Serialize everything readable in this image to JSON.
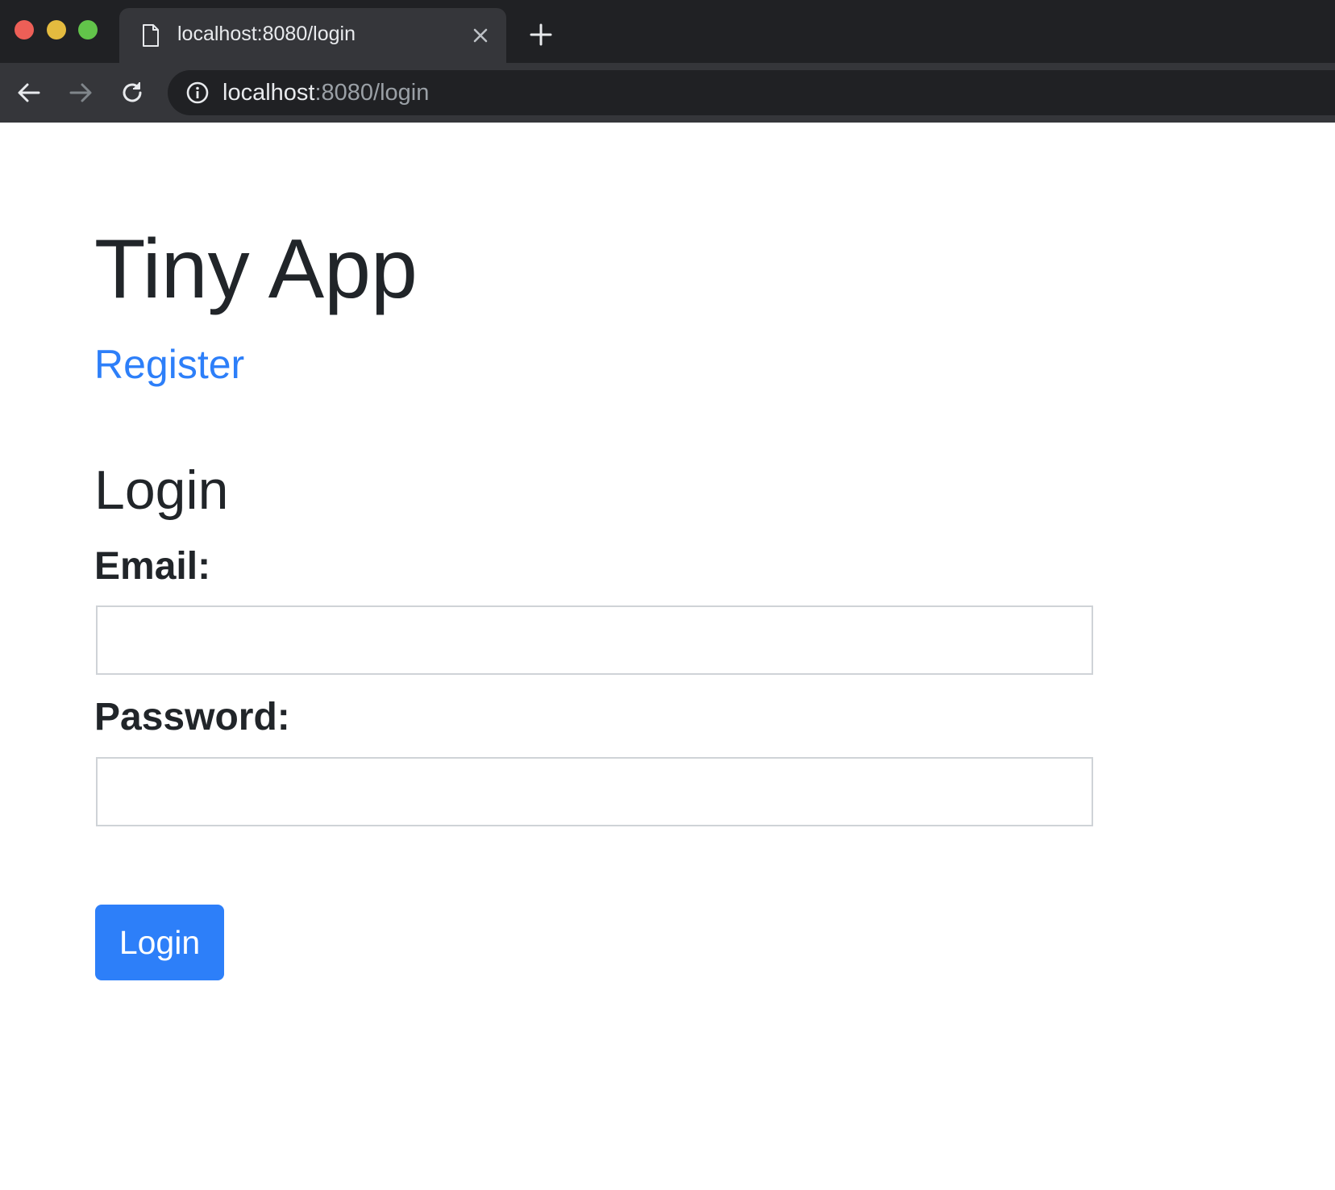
{
  "browser": {
    "tab": {
      "title": "localhost:8080/login",
      "doc_icon": "document-icon",
      "close_icon": "close-icon"
    },
    "new_tab_icon": "plus-icon",
    "nav": {
      "back_icon": "arrow-left-icon",
      "forward_icon": "arrow-right-icon",
      "reload_icon": "reload-icon"
    },
    "omnibox": {
      "info_icon": "info-icon",
      "url_host": "localhost",
      "url_rest": ":8080/login"
    },
    "window_controls": {
      "close_color": "#ed5f57",
      "minimize_color": "#e4bb3f",
      "maximize_color": "#62c44a"
    }
  },
  "page": {
    "app_title": "Tiny App",
    "register_link": "Register",
    "login_heading": "Login",
    "form": {
      "email_label": "Email:",
      "email_value": "",
      "password_label": "Password:",
      "password_value": "",
      "submit_label": "Login"
    }
  },
  "colors": {
    "accent": "#2d7ff9",
    "text": "#212529",
    "chrome_dark": "#202124",
    "chrome_mid": "#35363a"
  }
}
